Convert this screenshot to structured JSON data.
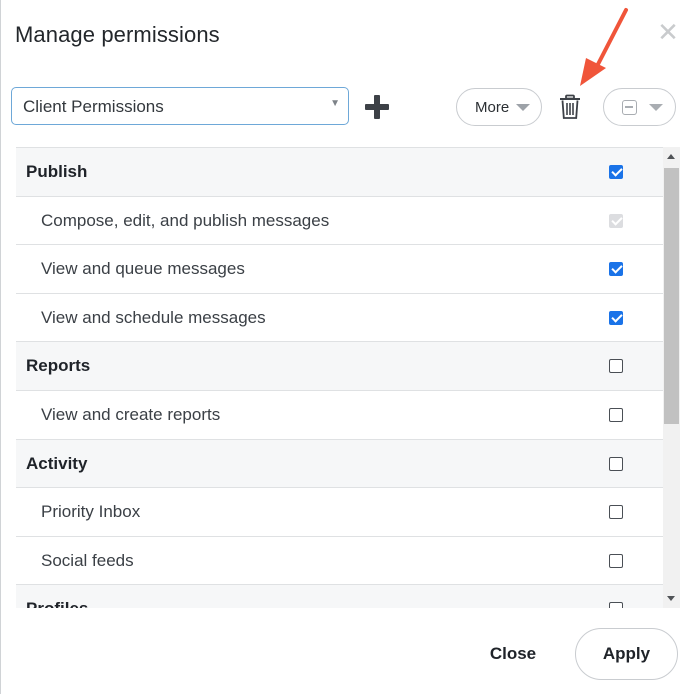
{
  "dialog": {
    "title": "Manage permissions",
    "close_icon": "close-icon"
  },
  "toolbar": {
    "select_value": "Client Permissions",
    "more_label": "More",
    "icons": [
      "plus-icon",
      "trash-icon",
      "bulk-checkbox-icon",
      "chevron-down-icon"
    ]
  },
  "permissions": [
    {
      "label": "Publish",
      "type": "group",
      "checked": true
    },
    {
      "label": "Compose, edit, and publish messages",
      "type": "item",
      "checked": true,
      "disabled": true
    },
    {
      "label": "View and queue messages",
      "type": "item",
      "checked": true
    },
    {
      "label": "View and schedule messages",
      "type": "item",
      "checked": true
    },
    {
      "label": "Reports",
      "type": "group",
      "checked": false
    },
    {
      "label": "View and create reports",
      "type": "item",
      "checked": false
    },
    {
      "label": "Activity",
      "type": "group",
      "checked": false
    },
    {
      "label": "Priority Inbox",
      "type": "item",
      "checked": false
    },
    {
      "label": "Social feeds",
      "type": "item",
      "checked": false
    },
    {
      "label": "Profiles",
      "type": "group",
      "checked": false
    }
  ],
  "footer": {
    "close_label": "Close",
    "apply_label": "Apply"
  },
  "colors": {
    "accent": "#1a73e8",
    "annotation_arrow": "#f0553a"
  }
}
